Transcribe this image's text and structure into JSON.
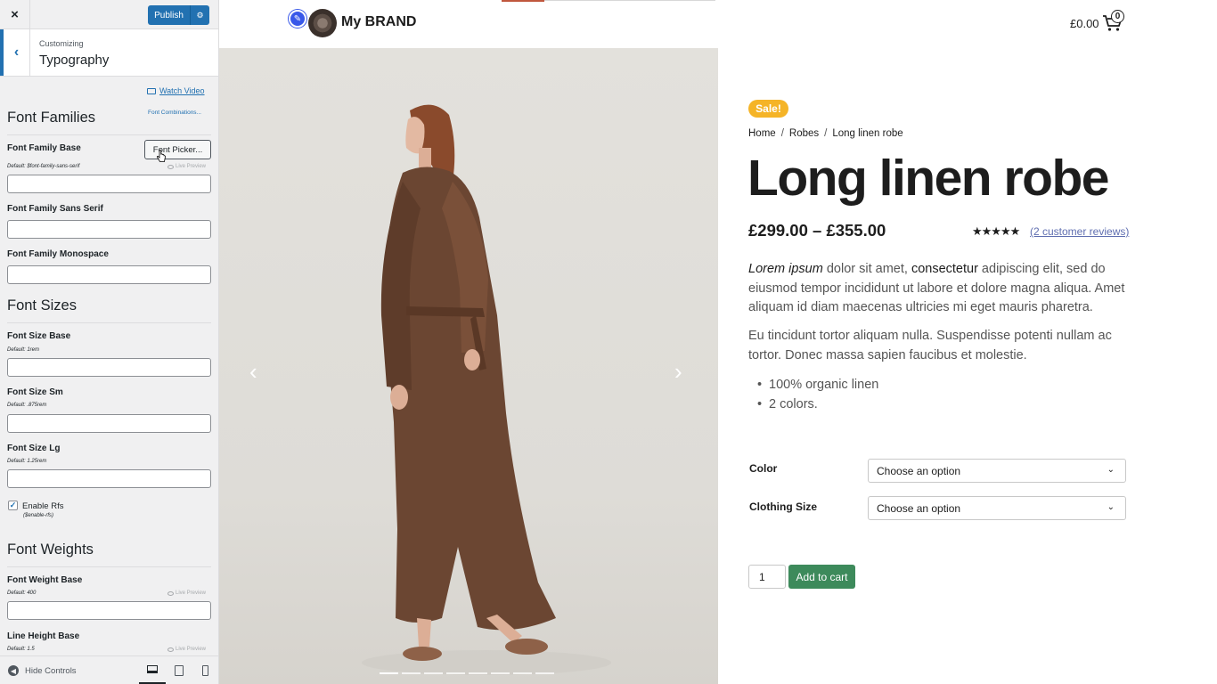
{
  "customizer": {
    "close_glyph": "×",
    "publish_label": "Publish",
    "gear_glyph": "⚙",
    "back_glyph": "‹",
    "customizing_label": "Customizing",
    "section_title": "Typography",
    "watch_video": "Watch Video",
    "font_families": {
      "heading": "Font Families",
      "combinations_link": "Font Combinations...",
      "base_label": "Font Family Base",
      "base_default": "Default: $font-family-sans-serif",
      "font_picker_label": "Font Picker...",
      "live_preview": "Live Preview",
      "sans_label": "Font Family Sans Serif",
      "mono_label": "Font Family Monospace"
    },
    "font_sizes": {
      "heading": "Font Sizes",
      "base_label": "Font Size Base",
      "base_default": "Default: 1rem",
      "sm_label": "Font Size Sm",
      "sm_default": "Default: .875rem",
      "lg_label": "Font Size Lg",
      "lg_default": "Default: 1.25rem",
      "rfs_label": "Enable Rfs",
      "rfs_sub": "($enable-rfs)",
      "rfs_checked": true
    },
    "font_weights": {
      "heading": "Font Weights",
      "weight_label": "Font Weight Base",
      "weight_default": "Default: 400",
      "live_preview": "Live Preview",
      "lh_label": "Line Height Base",
      "lh_default": "Default: 1.5"
    },
    "footer": {
      "hide_controls": "Hide Controls",
      "active_device": "desktop"
    },
    "accent_color": "#2271b1"
  },
  "preview": {
    "brand_name": "My BRAND",
    "cart_total": "£0.00",
    "cart_count": "0",
    "gallery": {
      "prev_glyph": "‹",
      "next_glyph": "›",
      "slide_count": 8,
      "active_slide": 1
    },
    "sale_badge": "Sale!",
    "breadcrumb": [
      "Home",
      "Robes",
      "Long linen robe"
    ],
    "breadcrumb_sep": "/",
    "title": "Long linen robe",
    "price": "£299.00 – £355.00",
    "stars": "★★★★★",
    "reviews": "(2 customer reviews)",
    "description": {
      "p1_italic": "Lorem ipsum",
      "p1_a": " dolor sit amet, ",
      "p1_bold": "consectetur",
      "p1_b": " adipiscing elit, sed do eiusmod tempor incididunt ut labore et dolore magna aliqua. Amet aliquam id diam maecenas ultricies mi eget mauris pharetra.",
      "p2": "Eu tincidunt tortor aliquam nulla. Suspendisse potenti nullam ac tortor. Donec massa sapien faucibus et molestie.",
      "bullets": [
        "100% organic linen",
        "2 colors."
      ]
    },
    "options": [
      {
        "label": "Color",
        "value": "Choose an option"
      },
      {
        "label": "Clothing Size",
        "value": "Choose an option"
      }
    ],
    "quantity": "1",
    "add_to_cart": "Add to cart",
    "colors": {
      "sale": "#f5b427",
      "add_to_cart": "#3d8a5b",
      "reviews_link": "#5f6eb0",
      "robe": "#6b4632"
    }
  }
}
